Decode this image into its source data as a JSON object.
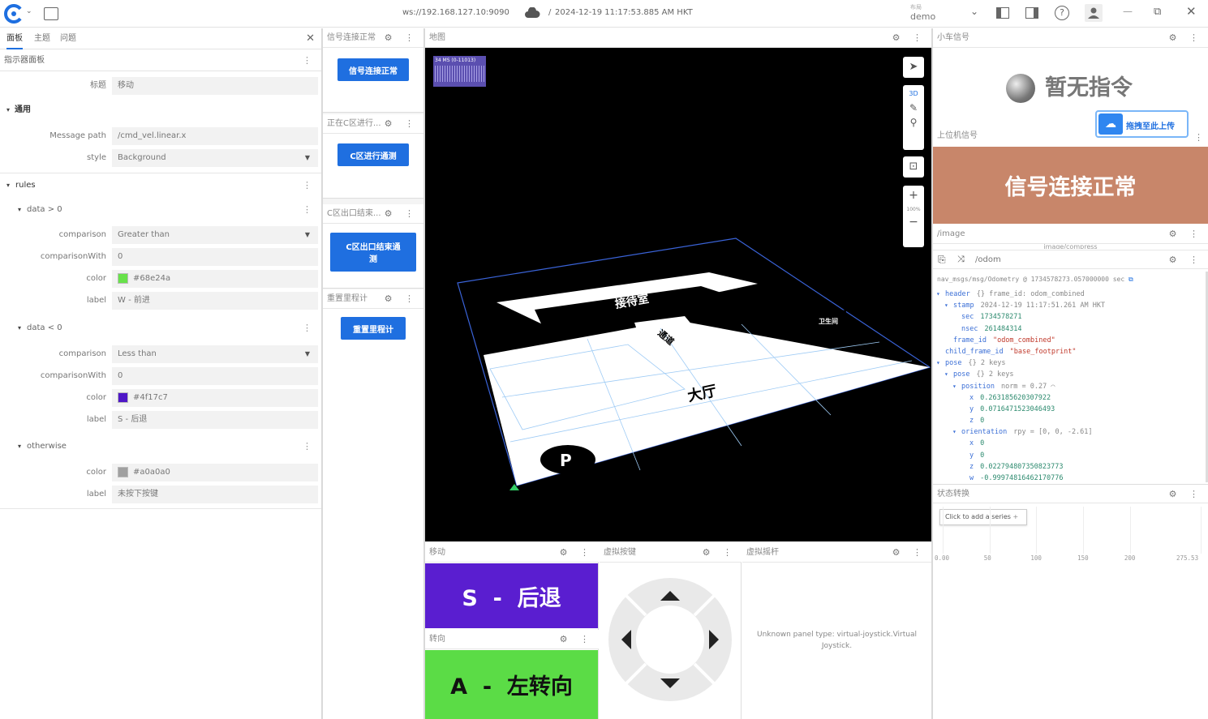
{
  "topbar": {
    "connection": "ws://192.168.127.10:9090",
    "time_sep": "/",
    "timestamp": "2024-12-19 11:17:53.885 AM HKT",
    "user_label": "布局",
    "user_name": "demo"
  },
  "left_panel": {
    "tabs": [
      "面板",
      "主题",
      "问题"
    ],
    "title": "指示器面板",
    "fields": {
      "title_label": "标题",
      "title_value": "移动",
      "general_section": "通用",
      "message_path_label": "Message path",
      "message_path_value": "/cmd_vel.linear.x",
      "style_label": "style",
      "style_value": "Background",
      "rules_section": "rules"
    },
    "rules": [
      {
        "name": "data > 0",
        "comparison": "Greater than",
        "comparisonWith": "0",
        "color": "#68e24a",
        "label": "W - 前进"
      },
      {
        "name": "data < 0",
        "comparison": "Less than",
        "comparisonWith": "0",
        "color": "#4f17c7",
        "label": "S - 后退"
      }
    ],
    "otherwise": {
      "name": "otherwise",
      "color": "#a0a0a0",
      "label": "未按下按键"
    },
    "labels": {
      "comparison": "comparison",
      "comparisonWith": "comparisonWith",
      "color": "color",
      "label": "label"
    }
  },
  "mid_panels": [
    {
      "title": "信号连接正常",
      "button": "信号连接正常"
    },
    {
      "title": "正在C区进行...",
      "button": "C区进行通测"
    },
    {
      "title": "C区出口结束...",
      "button": "C区出口结束通\n测"
    },
    {
      "title": "重置里程计",
      "button": "重置里程计"
    }
  ],
  "map_panel": {
    "title": "地图",
    "fps": "34 MS (0-11013)",
    "mode_3d": "3D",
    "zoom": "100%",
    "rooms": [
      "接待室",
      "通道",
      "大厅",
      "P",
      "卫生间"
    ],
    "tools": [
      "select-icon",
      "ruler-icon",
      "pin-icon",
      "focus-icon",
      "plus-icon",
      "minus-icon"
    ]
  },
  "bottom_panels": {
    "move": {
      "title": "移动",
      "text": "S  -  后退",
      "color": "#5a1ed0"
    },
    "turn": {
      "title": "转向",
      "text": "A  -  左转向",
      "color": "#5bdc46"
    },
    "keys": {
      "title": "虚拟按键"
    },
    "joystick": {
      "title": "虚拟摇杆",
      "message": "Unknown panel type: virtual-joystick.Virtual Joystick."
    }
  },
  "right_panels": {
    "small_car": {
      "title": "小车信号",
      "text": "暂无指令"
    },
    "upload_btn": "拖拽至此上传",
    "upper": {
      "title": "上位机信号",
      "text": "信号连接正常",
      "color": "#c8866a"
    },
    "image": {
      "title": "/image",
      "sub": "image/compress"
    },
    "odom": {
      "title": "/odom",
      "meta": "nav_msgs/msg/Odometry @ 1734578273.057000000 sec",
      "lines": [
        {
          "indent": 0,
          "arrow": "▾",
          "key": "header",
          "val": "{} frame_id: odom_combined"
        },
        {
          "indent": 1,
          "arrow": "▾",
          "key": "stamp",
          "val": "2024-12-19 11:17:51.261 AM HKT"
        },
        {
          "indent": 2,
          "arrow": "",
          "key": "sec",
          "val": "1734578271"
        },
        {
          "indent": 2,
          "arrow": "",
          "key": "nsec",
          "val": "261484314"
        },
        {
          "indent": 1,
          "arrow": "",
          "key": "frame_id",
          "val": "\"odom_combined\""
        },
        {
          "indent": 0,
          "arrow": "",
          "key": "child_frame_id",
          "val": "\"base_footprint\""
        },
        {
          "indent": 0,
          "arrow": "▾",
          "key": "pose",
          "val": "{} 2 keys"
        },
        {
          "indent": 1,
          "arrow": "▾",
          "key": "pose",
          "val": "{} 2 keys"
        },
        {
          "indent": 2,
          "arrow": "▾",
          "key": "position",
          "val": "norm = 0.27 ⌒"
        },
        {
          "indent": 3,
          "arrow": "",
          "key": "x",
          "val": "0.263185620307922"
        },
        {
          "indent": 3,
          "arrow": "",
          "key": "y",
          "val": "0.0716471523046493"
        },
        {
          "indent": 3,
          "arrow": "",
          "key": "z",
          "val": "0"
        },
        {
          "indent": 2,
          "arrow": "▾",
          "key": "orientation",
          "val": "rpy = [0, 0, -2.61]"
        },
        {
          "indent": 3,
          "arrow": "",
          "key": "x",
          "val": "0"
        },
        {
          "indent": 3,
          "arrow": "",
          "key": "y",
          "val": "0"
        },
        {
          "indent": 3,
          "arrow": "",
          "key": "z",
          "val": "0.022794807350823773"
        },
        {
          "indent": 3,
          "arrow": "",
          "key": "w",
          "val": "-0.99974816462170776"
        }
      ]
    },
    "state": {
      "title": "状态转换",
      "add_series": "Click to add a series",
      "ticks": [
        "0.00",
        "50",
        "100",
        "150",
        "200",
        "275.53"
      ]
    }
  }
}
